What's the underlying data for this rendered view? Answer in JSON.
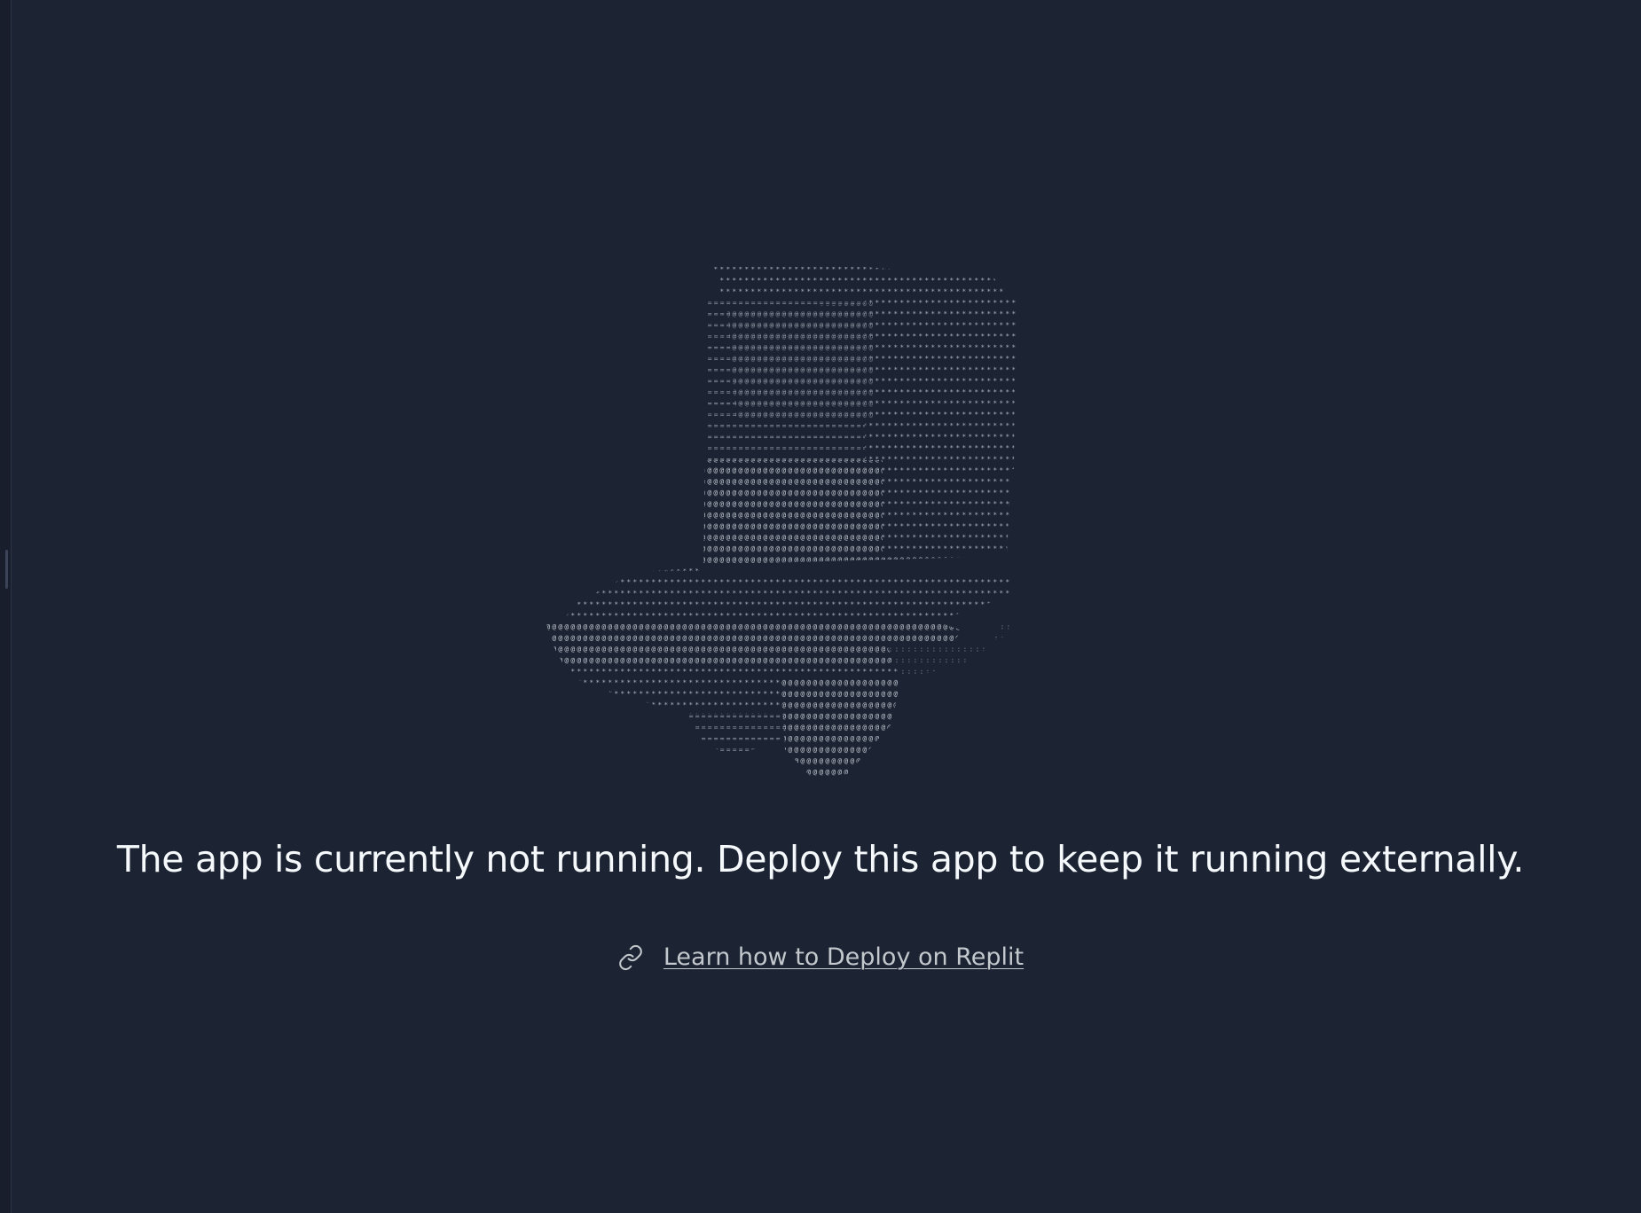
{
  "page": {
    "background": "#1c2333",
    "illustration_icon": "ascii-art-top-hat",
    "message": "The app is currently not running. Deploy this app to keep it running externally.",
    "learn_link": {
      "icon": "link-icon",
      "label": "Learn how to Deploy on Replit"
    }
  },
  "colors": {
    "text_primary": "#f5f9fc",
    "text_link": "#c2c8cc",
    "ascii_art": "#b7bdc6"
  }
}
